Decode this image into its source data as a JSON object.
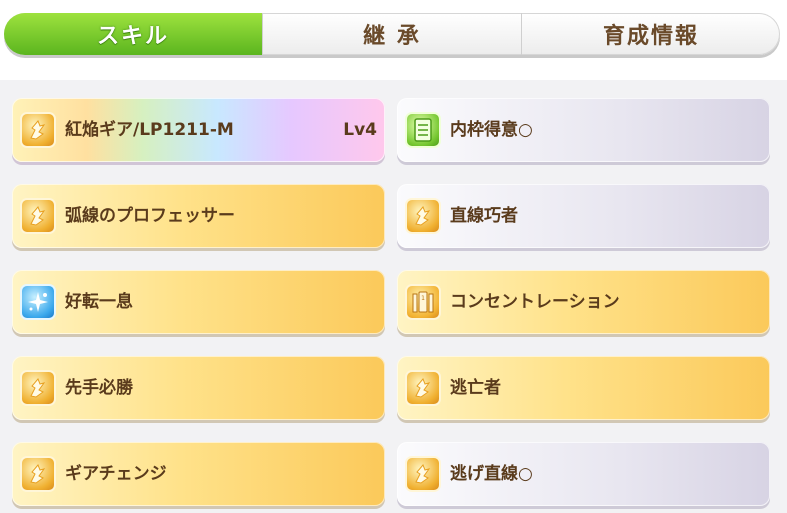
{
  "tabs": [
    {
      "label": "スキル",
      "active": true
    },
    {
      "label": "継 承",
      "active": false
    },
    {
      "label": "育成情報",
      "active": false
    }
  ],
  "skills": [
    {
      "name": "紅焔ギア/LP1211-M",
      "level": "Lv4",
      "style": "rainbow",
      "icon": "speed-up-icon"
    },
    {
      "name": "内枠得意○",
      "style": "white",
      "icon": "green-skill-icon"
    },
    {
      "name": "弧線のプロフェッサー",
      "style": "gold",
      "icon": "speed-up-icon"
    },
    {
      "name": "直線巧者",
      "style": "white",
      "icon": "speed-up-icon"
    },
    {
      "name": "好転一息",
      "style": "gold",
      "icon": "stamina-recovery-icon"
    },
    {
      "name": "コンセントレーション",
      "style": "gold",
      "icon": "starting-gate-icon"
    },
    {
      "name": "先手必勝",
      "style": "gold",
      "icon": "speed-up-icon"
    },
    {
      "name": "逃亡者",
      "style": "gold",
      "icon": "speed-up-icon"
    },
    {
      "name": "ギアチェンジ",
      "style": "gold",
      "icon": "speed-up-icon"
    },
    {
      "name": "逃げ直線○",
      "style": "white",
      "icon": "speed-up-icon"
    }
  ],
  "colors": {
    "active_tab": "#5bb51f",
    "text_brown": "#5a3b1c",
    "gold_card": "#fbc95a",
    "white_card": "#e8e6f0"
  }
}
